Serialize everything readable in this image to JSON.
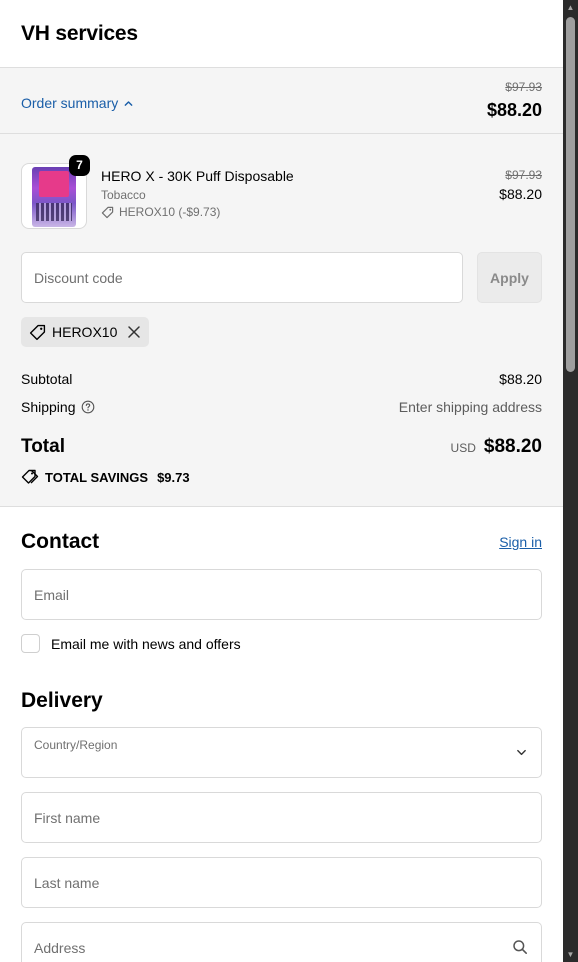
{
  "header": {
    "shop_name": "VH services"
  },
  "summary_bar": {
    "toggle_label": "Order summary",
    "compare_price": "$97.93",
    "total": "$88.20"
  },
  "product": {
    "quantity": "7",
    "title": "HERO X - 30K Puff Disposable",
    "variant": "Tobacco",
    "discount": "HEROX10 (-$9.73)",
    "compare_price": "$97.93",
    "price": "$88.20"
  },
  "discount": {
    "placeholder": "Discount code",
    "apply_label": "Apply",
    "applied_code": "HEROX10"
  },
  "totals": {
    "subtotal_label": "Subtotal",
    "subtotal_value": "$88.20",
    "shipping_label": "Shipping",
    "shipping_value": "Enter shipping address",
    "total_label": "Total",
    "currency": "USD",
    "total_value": "$88.20",
    "savings_label": "TOTAL SAVINGS",
    "savings_value": "$9.73"
  },
  "contact": {
    "title": "Contact",
    "sign_in": "Sign in",
    "email_placeholder": "Email",
    "newsletter_label": "Email me with news and offers"
  },
  "delivery": {
    "title": "Delivery",
    "country_label": "Country/Region",
    "first_name_placeholder": "First name",
    "last_name_placeholder": "Last name",
    "address_placeholder": "Address"
  },
  "colors": {
    "link": "#1a5ea8",
    "summary_bg": "#f5f5f5",
    "border": "#d9d9d9"
  }
}
